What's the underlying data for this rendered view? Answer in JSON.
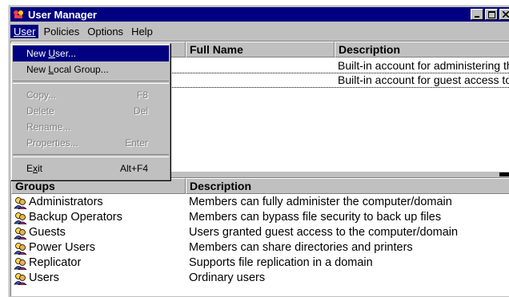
{
  "window": {
    "title": "User Manager"
  },
  "menubar": [
    "User",
    "Policies",
    "Options",
    "Help"
  ],
  "user_menu": {
    "items": [
      {
        "label": "New User...",
        "accel": "",
        "enabled": true,
        "selected": true
      },
      {
        "label": "New Local Group...",
        "accel": "",
        "enabled": true,
        "selected": false
      },
      {
        "label": "Copy...",
        "accel": "F8",
        "enabled": false,
        "selected": false
      },
      {
        "label": "Delete",
        "accel": "Del",
        "enabled": false,
        "selected": false
      },
      {
        "label": "Rename...",
        "accel": "",
        "enabled": false,
        "selected": false
      },
      {
        "label": "Properties...",
        "accel": "Enter",
        "enabled": false,
        "selected": false
      },
      {
        "label": "Exit",
        "accel": "Alt+F4",
        "enabled": true,
        "selected": false
      }
    ]
  },
  "users_table": {
    "headers": {
      "fullname": "Full Name",
      "description": "Description"
    },
    "rows": [
      {
        "description": "Built-in account for administering the computer/domain"
      },
      {
        "description": "Built-in account for guest access to the computer/domain"
      }
    ]
  },
  "groups_table": {
    "headers": {
      "groups": "Groups",
      "description": "Description"
    },
    "rows": [
      {
        "name": "Administrators",
        "description": "Members can fully administer the computer/domain"
      },
      {
        "name": "Backup Operators",
        "description": "Members can bypass file security to back up files"
      },
      {
        "name": "Guests",
        "description": "Users granted guest access to the computer/domain"
      },
      {
        "name": "Power Users",
        "description": "Members can share directories and printers"
      },
      {
        "name": "Replicator",
        "description": "Supports file replication in a domain"
      },
      {
        "name": "Users",
        "description": "Ordinary users"
      }
    ]
  },
  "icons": {
    "group": "group-icon",
    "app": "user-manager-icon"
  },
  "colors": {
    "titlebar": "#000080",
    "highlight": "#000080",
    "face": "#c0c0c0"
  }
}
